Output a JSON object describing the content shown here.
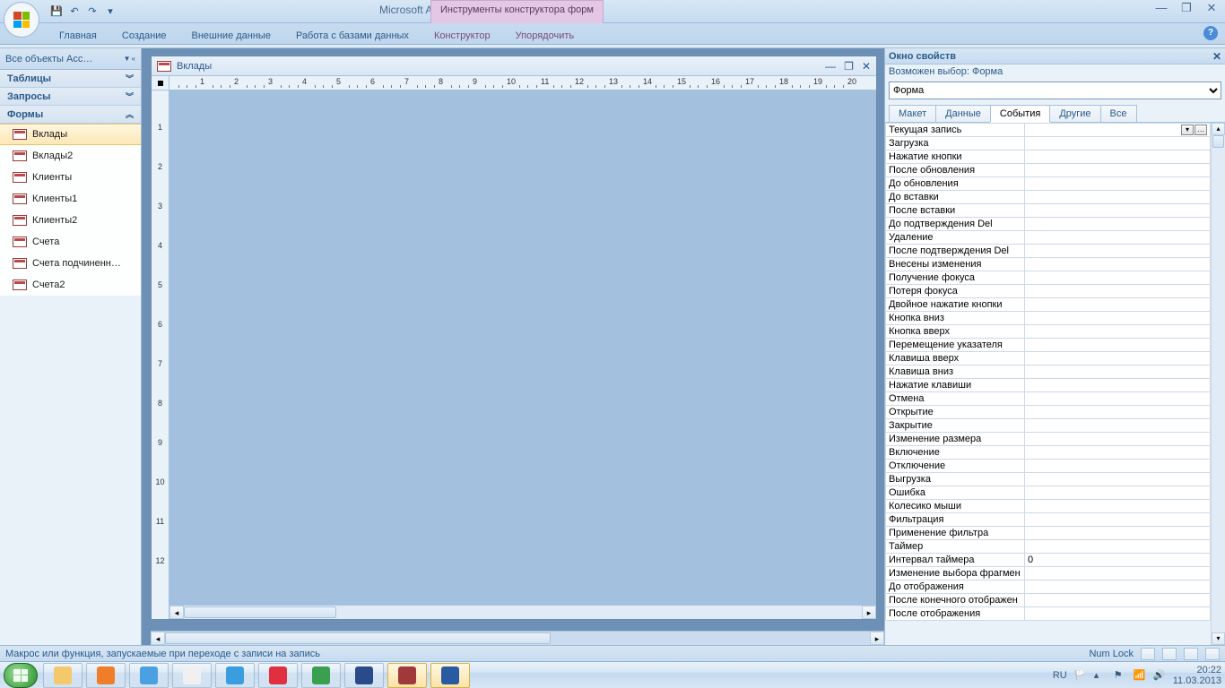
{
  "title": {
    "app": "Microsoft Access",
    "context": "Инструменты конструктора форм"
  },
  "ribbon": {
    "tabs": [
      "Главная",
      "Создание",
      "Внешние данные",
      "Работа с базами данных"
    ],
    "ctx_tabs": [
      "Конструктор",
      "Упорядочить"
    ]
  },
  "nav": {
    "header": "Все объекты Acc…",
    "sections": [
      {
        "title": "Таблицы",
        "expanded": false,
        "items": []
      },
      {
        "title": "Запросы",
        "expanded": false,
        "items": []
      },
      {
        "title": "Формы",
        "expanded": true,
        "items": [
          "Вклады",
          "Вклады2",
          "Клиенты",
          "Клиенты1",
          "Клиенты2",
          "Счета",
          "Счета подчиненн…",
          "Счета2"
        ],
        "selected": 0
      }
    ]
  },
  "form": {
    "title": "Вклады"
  },
  "ruler": {
    "h": [
      1,
      2,
      3,
      4,
      5,
      6,
      7,
      8,
      9,
      10,
      11,
      12,
      13,
      14,
      15,
      16,
      17,
      18,
      19,
      20
    ],
    "v": [
      1,
      2,
      3,
      4,
      5,
      6,
      7,
      8,
      9,
      10,
      11,
      12
    ]
  },
  "props": {
    "title": "Окно свойств",
    "subtitle_prefix": "Возможен выбор:",
    "subtitle_value": "Форма",
    "selector": "Форма",
    "tabs": [
      "Макет",
      "Данные",
      "События",
      "Другие",
      "Все"
    ],
    "active_tab": 2,
    "events": [
      {
        "name": "Текущая запись",
        "value": "",
        "sel": true
      },
      {
        "name": "Загрузка",
        "value": ""
      },
      {
        "name": "Нажатие кнопки",
        "value": ""
      },
      {
        "name": "После обновления",
        "value": ""
      },
      {
        "name": "До обновления",
        "value": ""
      },
      {
        "name": "До вставки",
        "value": ""
      },
      {
        "name": "После вставки",
        "value": ""
      },
      {
        "name": "До подтверждения Del",
        "value": ""
      },
      {
        "name": "Удаление",
        "value": ""
      },
      {
        "name": "После подтверждения Del",
        "value": ""
      },
      {
        "name": "Внесены изменения",
        "value": ""
      },
      {
        "name": "Получение фокуса",
        "value": ""
      },
      {
        "name": "Потеря фокуса",
        "value": ""
      },
      {
        "name": "Двойное нажатие кнопки",
        "value": ""
      },
      {
        "name": "Кнопка вниз",
        "value": ""
      },
      {
        "name": "Кнопка вверх",
        "value": ""
      },
      {
        "name": "Перемещение указателя",
        "value": ""
      },
      {
        "name": "Клавиша вверх",
        "value": ""
      },
      {
        "name": "Клавиша вниз",
        "value": ""
      },
      {
        "name": "Нажатие клавиши",
        "value": ""
      },
      {
        "name": "Отмена",
        "value": ""
      },
      {
        "name": "Открытие",
        "value": ""
      },
      {
        "name": "Закрытие",
        "value": ""
      },
      {
        "name": "Изменение размера",
        "value": ""
      },
      {
        "name": "Включение",
        "value": ""
      },
      {
        "name": "Отключение",
        "value": ""
      },
      {
        "name": "Выгрузка",
        "value": ""
      },
      {
        "name": "Ошибка",
        "value": ""
      },
      {
        "name": "Колесико мыши",
        "value": ""
      },
      {
        "name": "Фильтрация",
        "value": ""
      },
      {
        "name": "Применение фильтра",
        "value": ""
      },
      {
        "name": "Таймер",
        "value": ""
      },
      {
        "name": "Интервал таймера",
        "value": "0"
      },
      {
        "name": "Изменение выбора фрагмен",
        "value": ""
      },
      {
        "name": "До отображения",
        "value": ""
      },
      {
        "name": "После конечного отображен",
        "value": ""
      },
      {
        "name": "После отображения",
        "value": ""
      }
    ]
  },
  "status": {
    "hint": "Макрос или функция, запускаемые при переходе с записи на запись",
    "lock": "Num Lock"
  },
  "taskbar": {
    "lang": "RU",
    "time": "20:22",
    "date": "11.03.2013",
    "apps": [
      {
        "name": "explorer",
        "color": "#f3c96b"
      },
      {
        "name": "wmp",
        "color": "#f07d2a"
      },
      {
        "name": "paint",
        "color": "#4aa0e0"
      },
      {
        "name": "chrome",
        "color": "#f0f0f0"
      },
      {
        "name": "ie",
        "color": "#3a9de0"
      },
      {
        "name": "opera",
        "color": "#e03040"
      },
      {
        "name": "mail",
        "color": "#3aa050"
      },
      {
        "name": "vbox",
        "color": "#2a4a8a"
      },
      {
        "name": "access",
        "color": "#a03a3a",
        "active": true
      },
      {
        "name": "word",
        "color": "#2a5aa0",
        "active": true
      }
    ]
  }
}
